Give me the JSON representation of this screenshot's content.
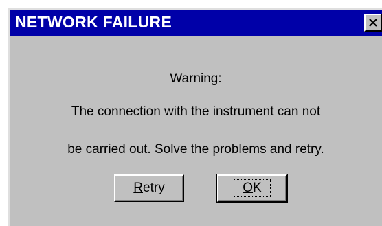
{
  "dialog": {
    "title": "NETWORK FAILURE",
    "close_icon": "close-icon",
    "message_heading": "Warning:",
    "message_line1": "The connection with the instrument can not",
    "message_line2": "be carried out. Solve the problems and retry.",
    "retry_mnemonic": "R",
    "retry_rest": "etry",
    "ok_mnemonic": "O",
    "ok_rest": "K"
  },
  "colors": {
    "titlebar": "#0000a8",
    "face": "#c0c0c0",
    "title_text": "#ffffff"
  }
}
